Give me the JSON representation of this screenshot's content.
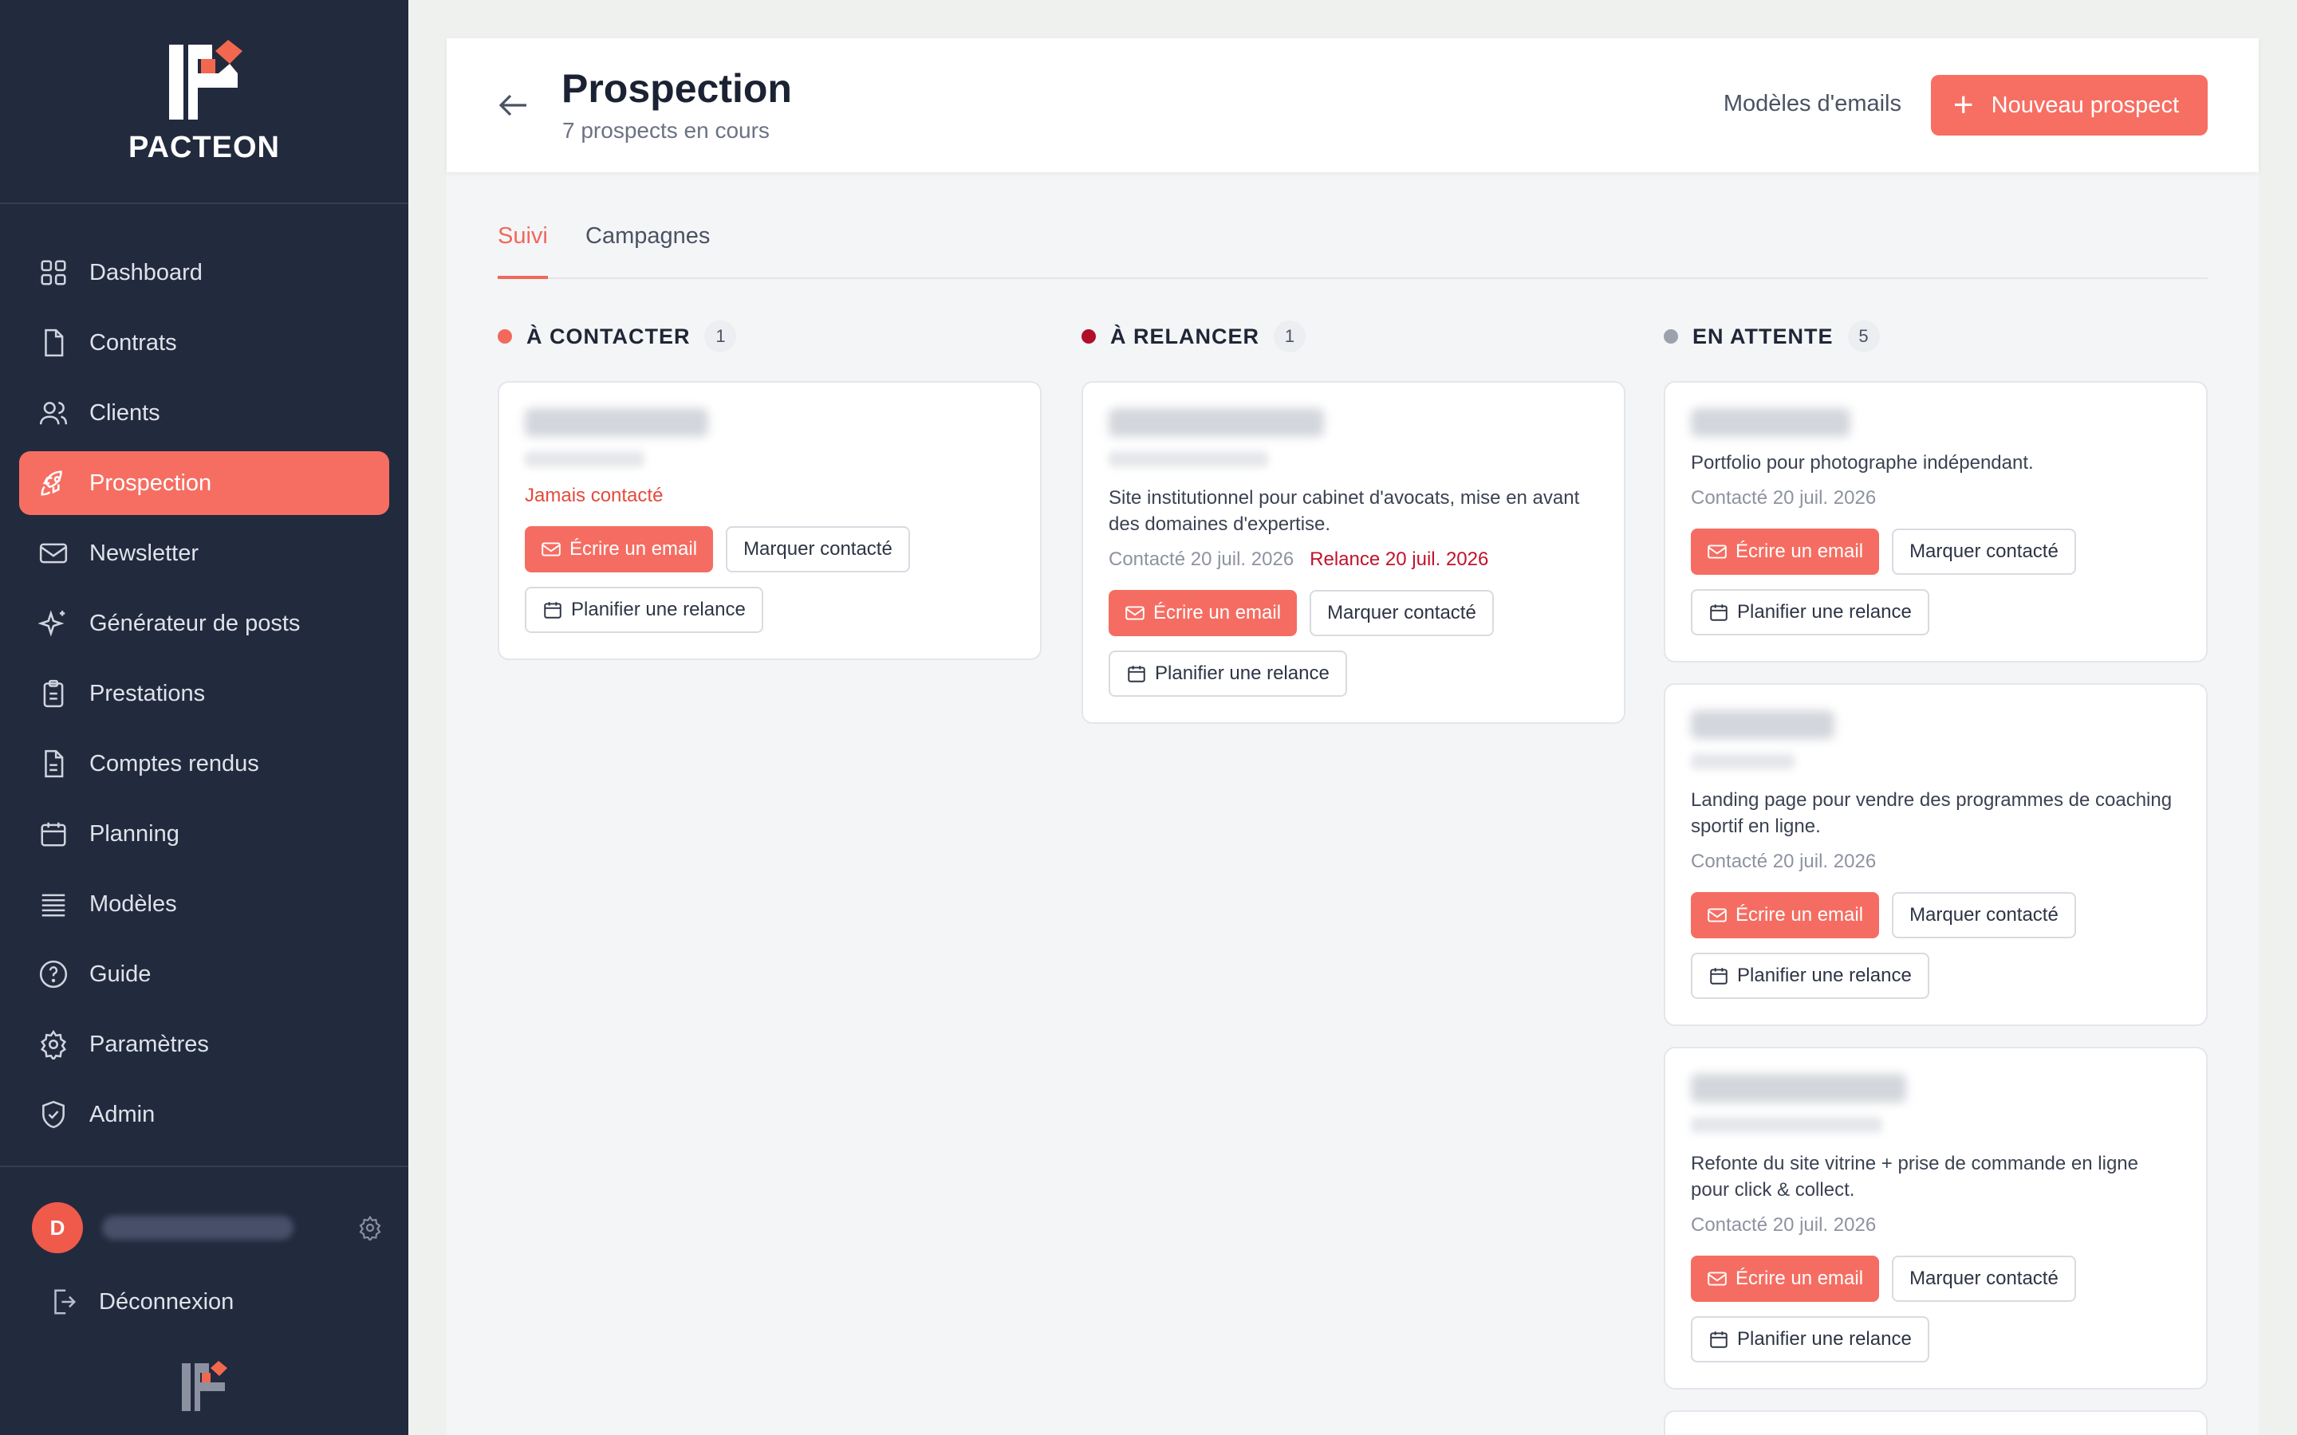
{
  "brand": {
    "name": "PACTEON"
  },
  "sidebar": {
    "items": [
      {
        "label": "Dashboard",
        "icon": "grid-icon",
        "active": false
      },
      {
        "label": "Contrats",
        "icon": "file-icon",
        "active": false
      },
      {
        "label": "Clients",
        "icon": "users-icon",
        "active": false
      },
      {
        "label": "Prospection",
        "icon": "rocket-icon",
        "active": true
      },
      {
        "label": "Newsletter",
        "icon": "mail-icon",
        "active": false
      },
      {
        "label": "Générateur de posts",
        "icon": "sparkles-icon",
        "active": false
      },
      {
        "label": "Prestations",
        "icon": "clipboard-icon",
        "active": false
      },
      {
        "label": "Comptes rendus",
        "icon": "file-text-icon",
        "active": false
      },
      {
        "label": "Planning",
        "icon": "calendar-icon",
        "active": false
      },
      {
        "label": "Modèles",
        "icon": "list-icon",
        "active": false
      },
      {
        "label": "Guide",
        "icon": "help-circle-icon",
        "active": false
      },
      {
        "label": "Paramètres",
        "icon": "gear-icon",
        "active": false
      },
      {
        "label": "Admin",
        "icon": "shield-check-icon",
        "active": false
      }
    ],
    "user": {
      "initial": "D"
    },
    "logout_label": "Déconnexion"
  },
  "header": {
    "title": "Prospection",
    "subtitle": "7 prospects en cours",
    "templates_link": "Modèles d'emails",
    "new_button": "Nouveau prospect"
  },
  "tabs": [
    {
      "label": "Suivi",
      "active": true
    },
    {
      "label": "Campagnes",
      "active": false
    }
  ],
  "columns": [
    {
      "title": "À CONTACTER",
      "count": "1",
      "dot_color": "#f2695b",
      "cards": [
        {
          "status": "Jamais contacté"
        }
      ]
    },
    {
      "title": "À RELANCER",
      "count": "1",
      "dot_color": "#b0102a",
      "cards": [
        {
          "description": "Site institutionnel pour cabinet d'avocats, mise en avant des domaines d'expertise.",
          "contacted": "Contacté 20 juil. 2026",
          "relance": "Relance 20 juil. 2026"
        }
      ]
    },
    {
      "title": "EN ATTENTE",
      "count": "5",
      "dot_color": "#9ca1ab",
      "cards": [
        {
          "description": "Portfolio pour photographe indépendant.",
          "contacted": "Contacté 20 juil. 2026"
        },
        {
          "description": "Landing page pour vendre des programmes de coaching sportif en ligne.",
          "contacted": "Contacté 20 juil. 2026"
        },
        {
          "description": "Refonte du site vitrine + prise de commande en ligne pour click & collect.",
          "contacted": "Contacté 20 juil. 2026"
        }
      ]
    }
  ],
  "card_actions": {
    "email": "Écrire un email",
    "mark": "Marquer contacté",
    "plan": "Planifier une relance"
  },
  "colors": {
    "accent": "#f66e62",
    "sidebar_bg": "#222a3e",
    "relance": "#c1122b"
  }
}
